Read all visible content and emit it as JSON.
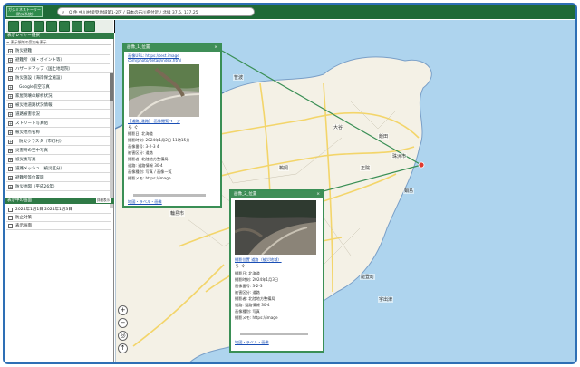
{
  "app": {
    "logo_line1": "ガジミネストーリー",
    "logo_line2": "(防災系統)"
  },
  "search": {
    "value": "Q 件 中川村能登地域第1-2区 / 日本の石川県付近 / 北緯 37.5, 137.25"
  },
  "sidebar": {
    "section1": "表示レイヤー選択",
    "sub1": "≡ 表示領域の案内を表示",
    "layers": [
      {
        "label": "防災避難"
      },
      {
        "label": "避難所（線・ポイント等）"
      },
      {
        "label": "ハザードマップ（国土地理院）"
      },
      {
        "label": "防災施設（海岸保全施設）"
      },
      {
        "label": "Google航空写真"
      },
      {
        "label": "家屋倒壊の解析状況"
      },
      {
        "label": "被災地道路状況情報"
      },
      {
        "label": "道路被害状況"
      },
      {
        "label": "ストリート写真帖"
      },
      {
        "label": "被災地点名称"
      },
      {
        "label": "防災クラスタ（市町村）"
      },
      {
        "label": "災害時の空中写真"
      },
      {
        "label": "被災後写真"
      },
      {
        "label": "道路メッシュ（被災区分）"
      },
      {
        "label": "避難所等位置図"
      },
      {
        "label": "防災地図（平成26年）"
      }
    ],
    "section2": "表示中の画面",
    "detail_btn": "詳細表示",
    "w_rows": [
      {
        "label": "2024年1月1日 2024年1月3日"
      },
      {
        "label": "防止対策"
      },
      {
        "label": "表示画面"
      }
    ]
  },
  "popup1": {
    "title": "画像_1_位置",
    "url_line1": "画像URL: https://test.image",
    "url_line2": "com/photo/detail/index.html",
    "caption": "【道路_道路】 画像閲覧ページ",
    "share_icons": "ら ぐ",
    "fields": [
      "撮影日: 北海道",
      "撮影時刻: 2024年1月2日 11時15分",
      "画像番号: 3-2-3 4",
      "被害区分: 道路",
      "撮影者: 北陸地方整備局",
      "道路: 道路情報 30-4",
      "画像種別: 写真 / 画像一覧",
      "撮影メモ: https://image"
    ],
    "footer": "地図・ラベル・画像"
  },
  "popup2": {
    "title": "画像_2_位置",
    "caption": "撮影位置 道路（被災地域）",
    "share_icons": "ら ぐ",
    "fields": [
      "撮影日: 北海道",
      "撮影時刻: 2024年1月3日",
      "画像番号: 3-2-3",
      "被害区分: 道路",
      "撮影者: 北陸地方整備局",
      "道路: 道路情報 30-4",
      "画像種別: 写真",
      "撮影メモ: https://image"
    ],
    "footer": "地図・ラベル・画像"
  },
  "map": {
    "places": [
      "珠洲市",
      "大谷",
      "笹波",
      "蛸島",
      "正院",
      "輪島市",
      "能登町",
      "鵜飼",
      "宇出津",
      "飯田"
    ]
  },
  "colors": {
    "header": "#1f6a37",
    "accent": "#3a8f55",
    "sea": "#aed4ee",
    "land": "#f4f1e6",
    "road": "#f3d56a"
  }
}
